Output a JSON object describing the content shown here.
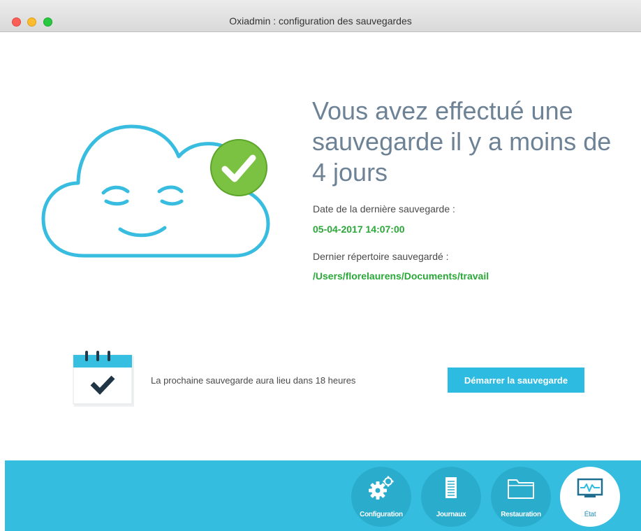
{
  "window": {
    "title": "Oxiadmin : configuration des sauvegardes"
  },
  "status": {
    "headline": "Vous avez effectué une sauvegarde il y a moins de 4 jours",
    "last_date_label": "Date de la dernière sauvegarde :",
    "last_date_value": "05-04-2017 14:07:00",
    "last_dir_label": "Dernier répertoire sauvegardé :",
    "last_dir_value": "/Users/florelaurens/Documents/travail"
  },
  "schedule": {
    "next_text": "La prochaine sauvegarde aura lieu dans 18 heures",
    "start_button": "Démarrer la sauvegarde"
  },
  "nav": {
    "items": [
      {
        "label": "Configuration",
        "icon": "gears-icon",
        "active": false
      },
      {
        "label": "Journaux",
        "icon": "document-icon",
        "active": false
      },
      {
        "label": "Restauration",
        "icon": "folder-icon",
        "active": false
      },
      {
        "label": "État",
        "icon": "monitor-pulse-icon",
        "active": true
      }
    ]
  },
  "colors": {
    "accent": "#2dbbe1",
    "success": "#2aa838",
    "headline": "#6e8296",
    "bar": "#34bddf"
  }
}
